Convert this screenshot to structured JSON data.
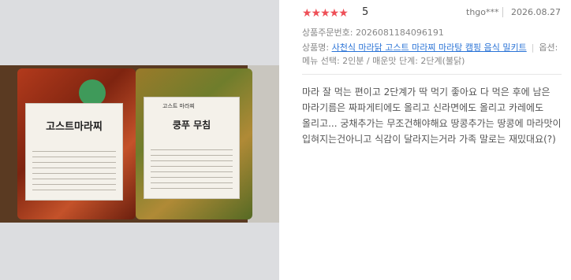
{
  "photo": {
    "left_package_label": "고스트마라찌",
    "right_package_label": "쿵푸 무침",
    "right_package_tag": "고스트 마라찌"
  },
  "review": {
    "rating": "5",
    "stars": "★★★★★",
    "user": "thgo***",
    "date": "2026.08.27",
    "order_number_label": "상품주문번호:",
    "order_number": "2026081184096191",
    "product_label": "상품명:",
    "product_name": "사천식 마라닭 고스트 마라찌 마라탕 캠핑 음식 밀키트",
    "option_label": "옵션:",
    "menu_selection": "메뉴 선택: 2인분 / 매운맛 단계: 2단계(불닭)",
    "text": "마라 잘 먹는 편이고 2단계가 딱 먹기 좋아요 다 먹은 후에 남은 마라기름은 짜파게티에도 올리고 신라면에도 올리고 카레에도 올리고... 궁채추가는 무조건해야해요 땅콩추가는 땅콩에 마라맛이 입혀지는건아니고 식감이 달라지는거라 가족 말로는 재밌대요(?)"
  },
  "colors": {
    "star": "#ee4f57",
    "link": "#2a73d6",
    "photo_panel": "#dcdde0"
  }
}
